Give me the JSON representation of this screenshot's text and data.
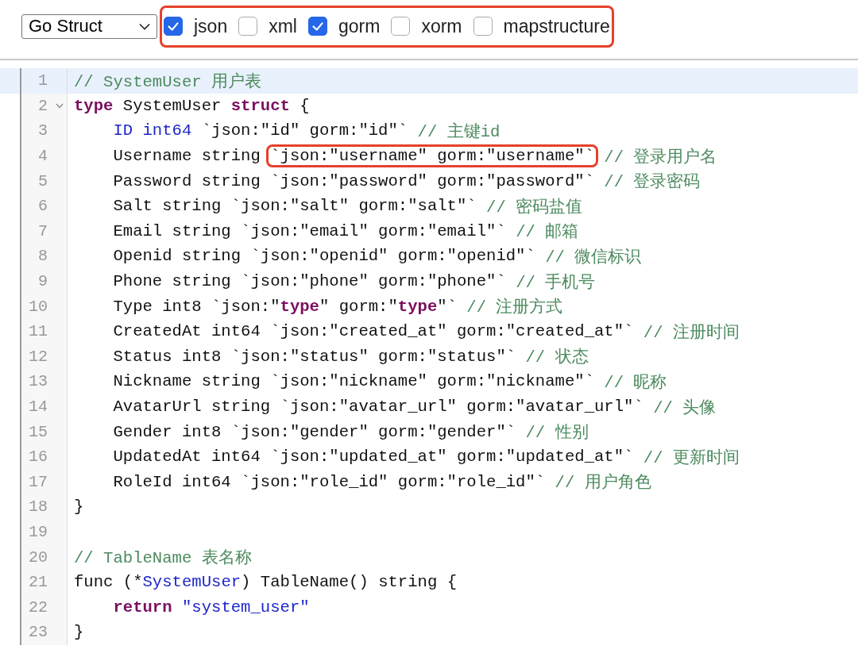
{
  "toolbar": {
    "language_select": {
      "value": "Go Struct"
    },
    "options_group": {
      "annotated": true,
      "options": [
        {
          "label": "json",
          "checked": true
        },
        {
          "label": "xml",
          "checked": false
        },
        {
          "label": "gorm",
          "checked": true
        },
        {
          "label": "xorm",
          "checked": false
        },
        {
          "label": "mapstructure",
          "checked": false
        }
      ]
    }
  },
  "editor": {
    "lines": [
      {
        "number": "1",
        "active": true,
        "tokens": [
          {
            "kind": "comment",
            "text": "// SystemUser 用户表"
          }
        ]
      },
      {
        "number": "2",
        "foldable": true,
        "tokens": [
          {
            "kind": "keyword",
            "text": "type"
          },
          {
            "kind": "plain",
            "text": " SystemUser "
          },
          {
            "kind": "keyword",
            "text": "struct"
          },
          {
            "kind": "plain",
            "text": " {"
          }
        ]
      },
      {
        "number": "3",
        "tokens": [
          {
            "kind": "type",
            "text": "    ID int64"
          },
          {
            "kind": "plain",
            "text": " `json:\"id\" gorm:\"id\"` "
          },
          {
            "kind": "comment",
            "text": "// 主键id"
          }
        ]
      },
      {
        "number": "4",
        "tokens": [
          {
            "kind": "plain",
            "text": "    Username string "
          },
          {
            "kind": "plain",
            "text": "`json:\"username\" gorm:\"username\"`",
            "annotated": true
          },
          {
            "kind": "comment",
            "text": " // 登录用户名"
          }
        ]
      },
      {
        "number": "5",
        "tokens": [
          {
            "kind": "plain",
            "text": "    Password string `json:\"password\" gorm:\"password\"` "
          },
          {
            "kind": "comment",
            "text": "// 登录密码"
          }
        ]
      },
      {
        "number": "6",
        "tokens": [
          {
            "kind": "plain",
            "text": "    Salt string `json:\"salt\" gorm:\"salt\"` "
          },
          {
            "kind": "comment",
            "text": "// 密码盐值"
          }
        ]
      },
      {
        "number": "7",
        "tokens": [
          {
            "kind": "plain",
            "text": "    Email string `json:\"email\" gorm:\"email\"` "
          },
          {
            "kind": "comment",
            "text": "// 邮箱"
          }
        ]
      },
      {
        "number": "8",
        "tokens": [
          {
            "kind": "plain",
            "text": "    Openid string `json:\"openid\" gorm:\"openid\"` "
          },
          {
            "kind": "comment",
            "text": "// 微信标识"
          }
        ]
      },
      {
        "number": "9",
        "tokens": [
          {
            "kind": "plain",
            "text": "    Phone string `json:\"phone\" gorm:\"phone\"` "
          },
          {
            "kind": "comment",
            "text": "// 手机号"
          }
        ]
      },
      {
        "number": "10",
        "tokens": [
          {
            "kind": "plain",
            "text": "    Type int8 `json:\""
          },
          {
            "kind": "keyword",
            "text": "type"
          },
          {
            "kind": "plain",
            "text": "\" gorm:\""
          },
          {
            "kind": "keyword",
            "text": "type"
          },
          {
            "kind": "plain",
            "text": "\"` "
          },
          {
            "kind": "comment",
            "text": "// 注册方式"
          }
        ]
      },
      {
        "number": "11",
        "tokens": [
          {
            "kind": "plain",
            "text": "    CreatedAt int64 `json:\"created_at\" gorm:\"created_at\"` "
          },
          {
            "kind": "comment",
            "text": "// 注册时间"
          }
        ]
      },
      {
        "number": "12",
        "tokens": [
          {
            "kind": "plain",
            "text": "    Status int8 `json:\"status\" gorm:\"status\"` "
          },
          {
            "kind": "comment",
            "text": "// 状态"
          }
        ]
      },
      {
        "number": "13",
        "tokens": [
          {
            "kind": "plain",
            "text": "    Nickname string `json:\"nickname\" gorm:\"nickname\"` "
          },
          {
            "kind": "comment",
            "text": "// 昵称"
          }
        ]
      },
      {
        "number": "14",
        "tokens": [
          {
            "kind": "plain",
            "text": "    AvatarUrl string `json:\"avatar_url\" gorm:\"avatar_url\"` "
          },
          {
            "kind": "comment",
            "text": "// 头像"
          }
        ]
      },
      {
        "number": "15",
        "tokens": [
          {
            "kind": "plain",
            "text": "    Gender int8 `json:\"gender\" gorm:\"gender\"` "
          },
          {
            "kind": "comment",
            "text": "// 性别"
          }
        ]
      },
      {
        "number": "16",
        "tokens": [
          {
            "kind": "plain",
            "text": "    UpdatedAt int64 `json:\"updated_at\" gorm:\"updated_at\"` "
          },
          {
            "kind": "comment",
            "text": "// 更新时间"
          }
        ]
      },
      {
        "number": "17",
        "tokens": [
          {
            "kind": "plain",
            "text": "    RoleId int64 `json:\"role_id\" gorm:\"role_id\"` "
          },
          {
            "kind": "comment",
            "text": "// 用户角色"
          }
        ]
      },
      {
        "number": "18",
        "tokens": [
          {
            "kind": "plain",
            "text": "}"
          }
        ]
      },
      {
        "number": "19"
      },
      {
        "number": "20",
        "tokens": [
          {
            "kind": "comment",
            "text": "// TableName 表名称"
          }
        ]
      },
      {
        "number": "21",
        "tokens": [
          {
            "kind": "plain",
            "text": "func (*"
          },
          {
            "kind": "type",
            "text": "SystemUser"
          },
          {
            "kind": "plain",
            "text": ") TableName() string {"
          }
        ]
      },
      {
        "number": "22",
        "tokens": [
          {
            "kind": "keyword",
            "text": "    return"
          },
          {
            "kind": "string",
            "text": " \"system_user\""
          }
        ]
      },
      {
        "number": "23",
        "tokens": [
          {
            "kind": "plain",
            "text": "}"
          }
        ]
      }
    ]
  }
}
